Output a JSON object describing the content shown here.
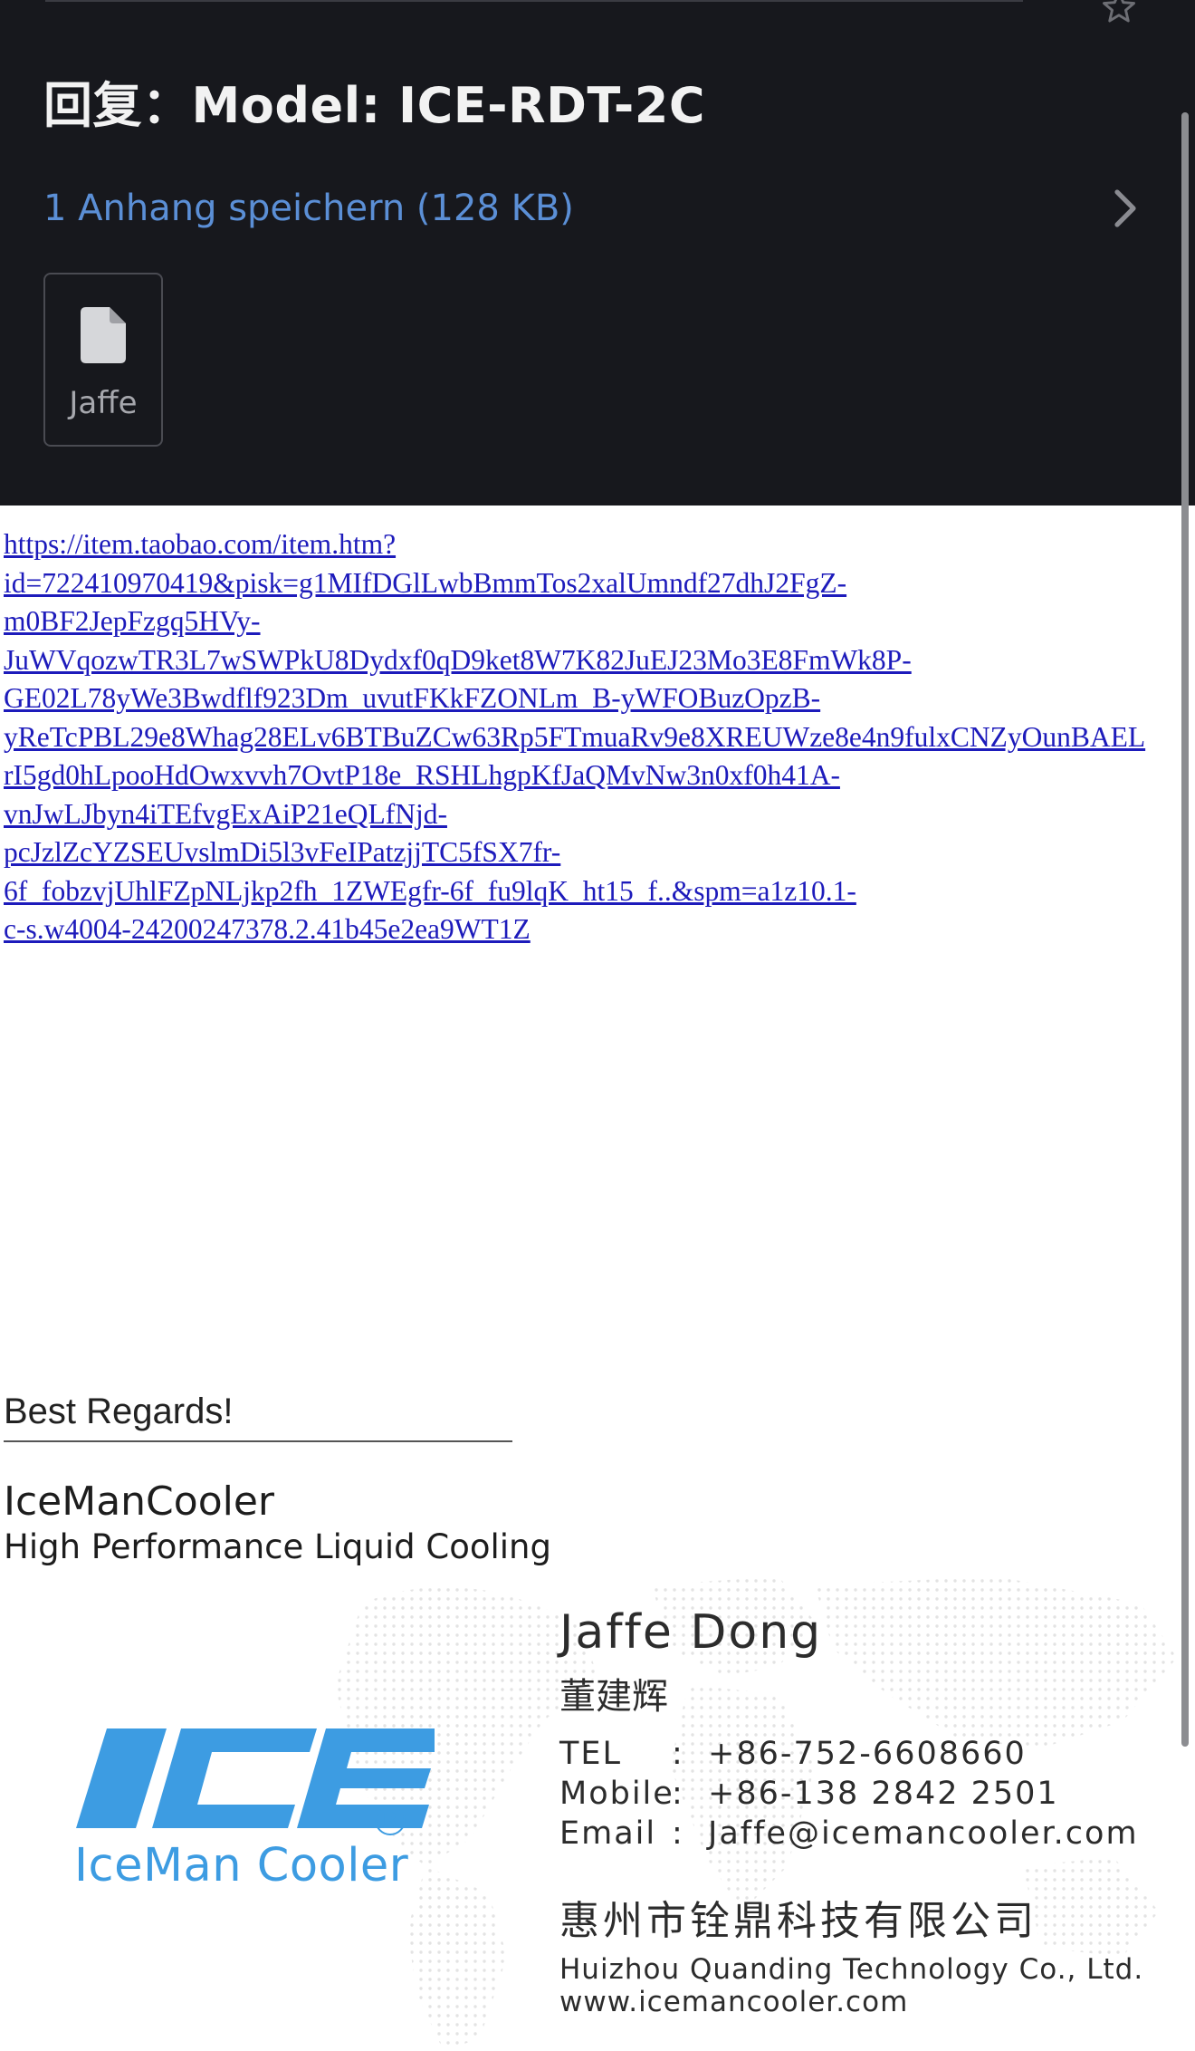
{
  "header": {
    "subject": "回复：Model: ICE-RDT-2C",
    "attachments_label": "1 Anhang speichern (128 KB)",
    "attachment": {
      "name": "Jaffe"
    }
  },
  "body": {
    "link_lines": [
      "https://item.taobao.com/item.htm?",
      "id=722410970419&pisk=g1MIfDGlLwbBmmTos2xalUmndf27dhJ2FgZ-",
      "m0BF2JepFzgq5HVy-",
      "JuWVqozwTR3L7wSWPkU8Dydxf0qD9ket8W7K82JuEJ23Mo3E8FmWk8P-",
      "GE02L78yWe3Bwdflf923Dm_uvutFKkFZONLm_B-yWFOBuzOpzB-",
      "yReTcPBL29e8Whag28ELv6BTBuZCw63Rp5FTmuaRv9e8XREUWze8e4n9fulxCNZyOunBAEL",
      "rI5gd0hLpooHdOwxvvh7OvtP18e_RSHLhgpKfJaQMvNw3n0xf0h41A-",
      "vnJwLJbyn4iTEfvgExAiP21eQLfNjd-",
      "pcJzlZcYZSEUvslmDi5l3vFeIPatzjjTC5fSX7fr-",
      "6f_fobzvjUhlFZpNLjkp2fh_1ZWEgfr-6f_fu9lqK_ht15_f..&spm=a1z10.1-",
      "c-s.w4004-24200247378.2.41b45e2ea9WT1Z"
    ]
  },
  "signature": {
    "regards": "Best Regards!",
    "rule": "———————————————————",
    "company": "IceManCooler",
    "tagline": "High Performance Liquid Cooling"
  },
  "card": {
    "brand": "IceMan Cooler",
    "name": "Jaffe Dong",
    "name_cn": "董建辉",
    "contacts": [
      {
        "key": "TEL",
        "sep": ":",
        "value": "+86-752-6608660"
      },
      {
        "key": "Mobile",
        "sep": ":",
        "value": "+86-138 2842 2501"
      },
      {
        "key": "Email",
        "sep": ":",
        "value": "Jaffe@icemancooler.com"
      }
    ],
    "company_cn": "惠州市铨鼎科技有限公司",
    "company_en": "Huizhou Quanding Technology Co., Ltd.",
    "website": "www.icemancooler.com"
  },
  "colors": {
    "header_bg": "#17181d",
    "link_blue": "#5b8fd6",
    "hyperlink": "#1d1bbb",
    "brand_blue": "#3d9ce2"
  },
  "icons": [
    "star-icon",
    "chevron-right-icon",
    "document-icon",
    "registered-mark-icon"
  ]
}
